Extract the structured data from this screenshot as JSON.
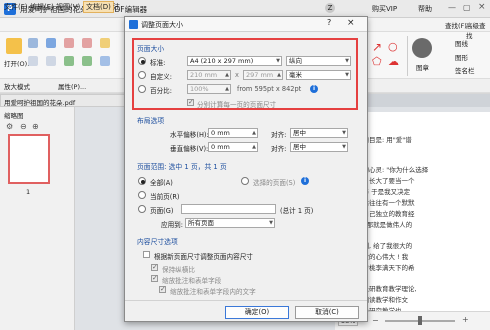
{
  "app": {
    "title": "用爱呵护祖国的花朵 - 迅捷PDF编辑器",
    "logo_letter": "P",
    "user_initial": "Z",
    "vip": "购买VIP",
    "help": "帮助"
  },
  "menus": [
    "文件(F)",
    "编辑(E)",
    "视图(V)",
    "文档(D)",
    "注"
  ],
  "ribbon": {
    "open": "打开(O)...",
    "snapshot_mode": "放大模式",
    "properties": "属性(P)...",
    "find": "查找(F)",
    "advanced_find": "高级查找",
    "image": "图章",
    "line": "图线",
    "rect": "图形",
    "signature": "签名栏"
  },
  "doc_tab": "用爱呵护祖国的花朵.pdf",
  "thumbnails": {
    "label": "缩略图",
    "page_num": "1"
  },
  "doc_text": [
    "的题目是: 用\"爱\"谱",
    "",
    "怀的心灵: \"你为什么选择",
    "的。长大了要当一个",
    "素养 于是我又决定",
    "背后往往有一个默默",
    "为自己独立的教育经",
    "得, 那就是做伟人的",
    "",
    "深刻, 给了我很大的",
    "用爱的心伟大 ! 我",
    "品曾桃李满天下的希",
    "",
    "育是研教育教学理论,",
    "在阅读教学和作文",
    "结合研究教学也..."
  ],
  "status": {
    "zoom": "58%"
  },
  "dialog": {
    "title": "调整页面大小",
    "help": "?",
    "close": "×",
    "page_size": {
      "section": "页面大小",
      "standard": {
        "label": "标准:",
        "value": "A4 (210 x 297 mm)",
        "orientation": "纵向"
      },
      "custom": {
        "label": "自定义:",
        "width": "210 mm",
        "x": "x",
        "height": "297 mm",
        "unit": "毫米"
      },
      "percent": {
        "label": "百分比:",
        "value": "100%",
        "from": "from 595pt x 842pt"
      },
      "separate_calc": "分别计算每一页的页面尺寸"
    },
    "layout": {
      "section": "布局选项",
      "h_offset": {
        "label": "水平偏移(H):",
        "value": "0 mm",
        "align_label": "对齐:",
        "align": "居中"
      },
      "v_offset": {
        "label": "垂直偏移(V):",
        "value": "0 mm",
        "align_label": "对齐:",
        "align": "居中"
      }
    },
    "page_range": {
      "section": "页面范围: 选中 1 页，共 1 页",
      "all": "全部(A)",
      "selected": "选择的页面(S)",
      "current": "当前页(R)",
      "pages": "页面(G)",
      "pages_total": "(总计 1 页)",
      "apply_label": "应用到:",
      "apply_value": "所有页面"
    },
    "content": {
      "section": "内容尺寸选项",
      "resize_content": "根据新页面尺寸调整页面内容尺寸",
      "preserve_ratio": "保持纵横比",
      "scale_annotations": "缩放批注和表单字段",
      "scale_stamp": "缩放批注和表单字段内的文字"
    },
    "ok": "确定(O)",
    "cancel": "取消(C)"
  },
  "colors": {
    "accent": "#1e6fd9",
    "highlight": "#e54040"
  }
}
